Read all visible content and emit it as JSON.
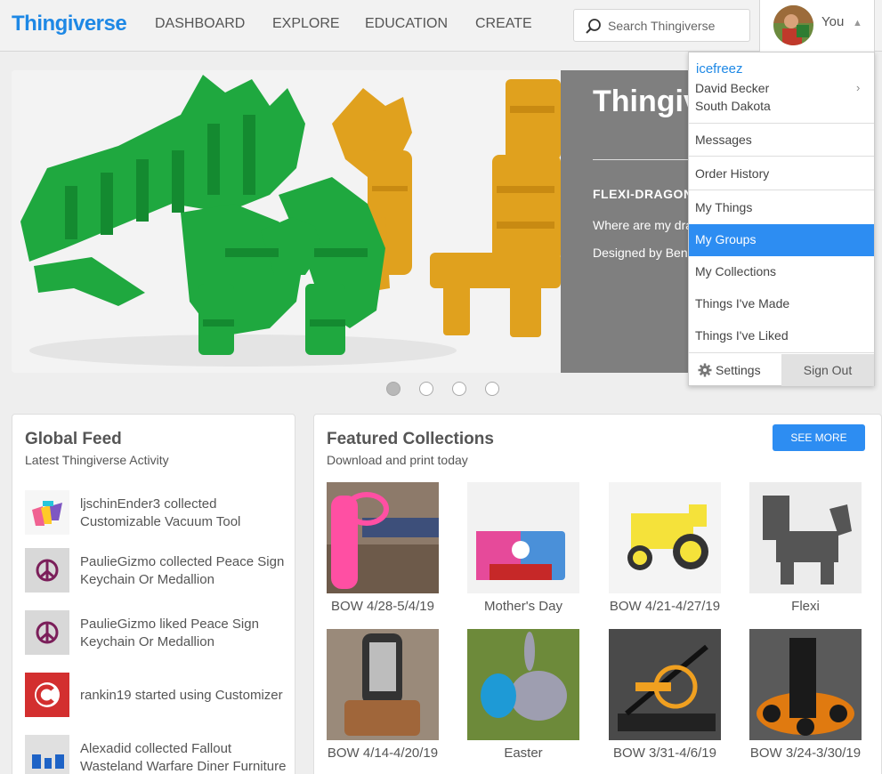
{
  "header": {
    "logo": "Thingiverse",
    "nav": [
      "DASHBOARD",
      "EXPLORE",
      "EDUCATION",
      "CREATE"
    ],
    "search_placeholder": "Search Thingiverse",
    "user_label": "You"
  },
  "hero": {
    "title": "Thingiverse",
    "subtitle": "FLEXI-DRAGON",
    "description": "Where are my dragons?",
    "designer": "Designed by Ben"
  },
  "dropdown": {
    "username": "icefreez",
    "full_name": "David Becker",
    "location": "South Dakota",
    "items": [
      "Messages",
      "Order History",
      "My Things",
      "My Groups",
      "My Collections",
      "Things I've Made",
      "Things I've Liked"
    ],
    "active_item": "My Groups",
    "settings": "Settings",
    "sign_out": "Sign Out"
  },
  "global_feed": {
    "title": "Global Feed",
    "subtitle": "Latest Thingiverse Activity",
    "items": [
      {
        "text": "ljschinEnder3 collected Customizable Vacuum Tool",
        "icon": "vacuum-tool-thumb"
      },
      {
        "text": "PaulieGizmo collected Peace Sign Keychain Or Medallion",
        "icon": "peace-sign-thumb"
      },
      {
        "text": "PaulieGizmo liked Peace Sign Keychain Or Medallion",
        "icon": "peace-sign-thumb"
      },
      {
        "text": "rankin19 started using Customizer",
        "icon": "customizer-logo"
      },
      {
        "text": "Alexadid collected Fallout Wasteland Warfare Diner Furniture",
        "icon": "diner-furniture-thumb"
      }
    ]
  },
  "featured": {
    "title": "Featured Collections",
    "subtitle": "Download and print today",
    "see_more": "SEE MORE",
    "collections": [
      "BOW 4/28-5/4/19",
      "Mother's Day",
      "BOW 4/21-4/27/19",
      "Flexi",
      "BOW 4/14-4/20/19",
      "Easter",
      "BOW 3/31-4/6/19",
      "BOW 3/24-3/30/19"
    ]
  },
  "carousel": {
    "slides": 4,
    "active": 1
  },
  "colors": {
    "brand": "#1e88e5",
    "accent": "#2d8df2",
    "hero_panel": "#787878"
  }
}
